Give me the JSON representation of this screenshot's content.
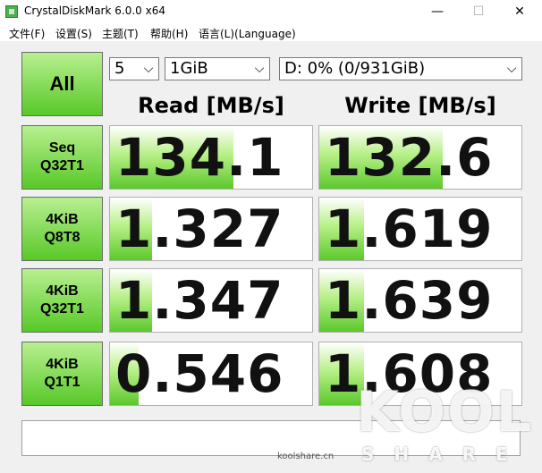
{
  "window": {
    "title": "CrystalDiskMark 6.0.0 x64",
    "minimize": "—",
    "maximize": "☐",
    "close": "✕"
  },
  "menu": [
    "文件(F)",
    "设置(S)",
    "主题(T)",
    "帮助(H)",
    "语言(L)(Language)"
  ],
  "controls": {
    "all_label": "All",
    "count": "5",
    "size": "1GiB",
    "drive": "D: 0% (0/931GiB)",
    "arrow": "⌵"
  },
  "headers": {
    "read": "Read [MB/s]",
    "write": "Write [MB/s]"
  },
  "rows": [
    {
      "line1": "Seq",
      "line2": "Q32T1",
      "read": "134.1",
      "write": "132.6",
      "read_fill": 0.61,
      "write_fill": 0.61
    },
    {
      "line1": "4KiB",
      "line2": "Q8T8",
      "read": "1.327",
      "write": "1.619",
      "read_fill": 0.21,
      "write_fill": 0.22
    },
    {
      "line1": "4KiB",
      "line2": "Q32T1",
      "read": "1.347",
      "write": "1.639",
      "read_fill": 0.21,
      "write_fill": 0.22
    },
    {
      "line1": "4KiB",
      "line2": "Q1T1",
      "read": "0.546",
      "write": "1.608",
      "read_fill": 0.14,
      "write_fill": 0.22
    }
  ],
  "comment": "",
  "watermark": {
    "brand": "KOOL",
    "sub": "SHARE",
    "url": "koolshare.cn"
  },
  "colors": {
    "accent_green": "#5cc82c",
    "light_green": "#b8f090"
  }
}
